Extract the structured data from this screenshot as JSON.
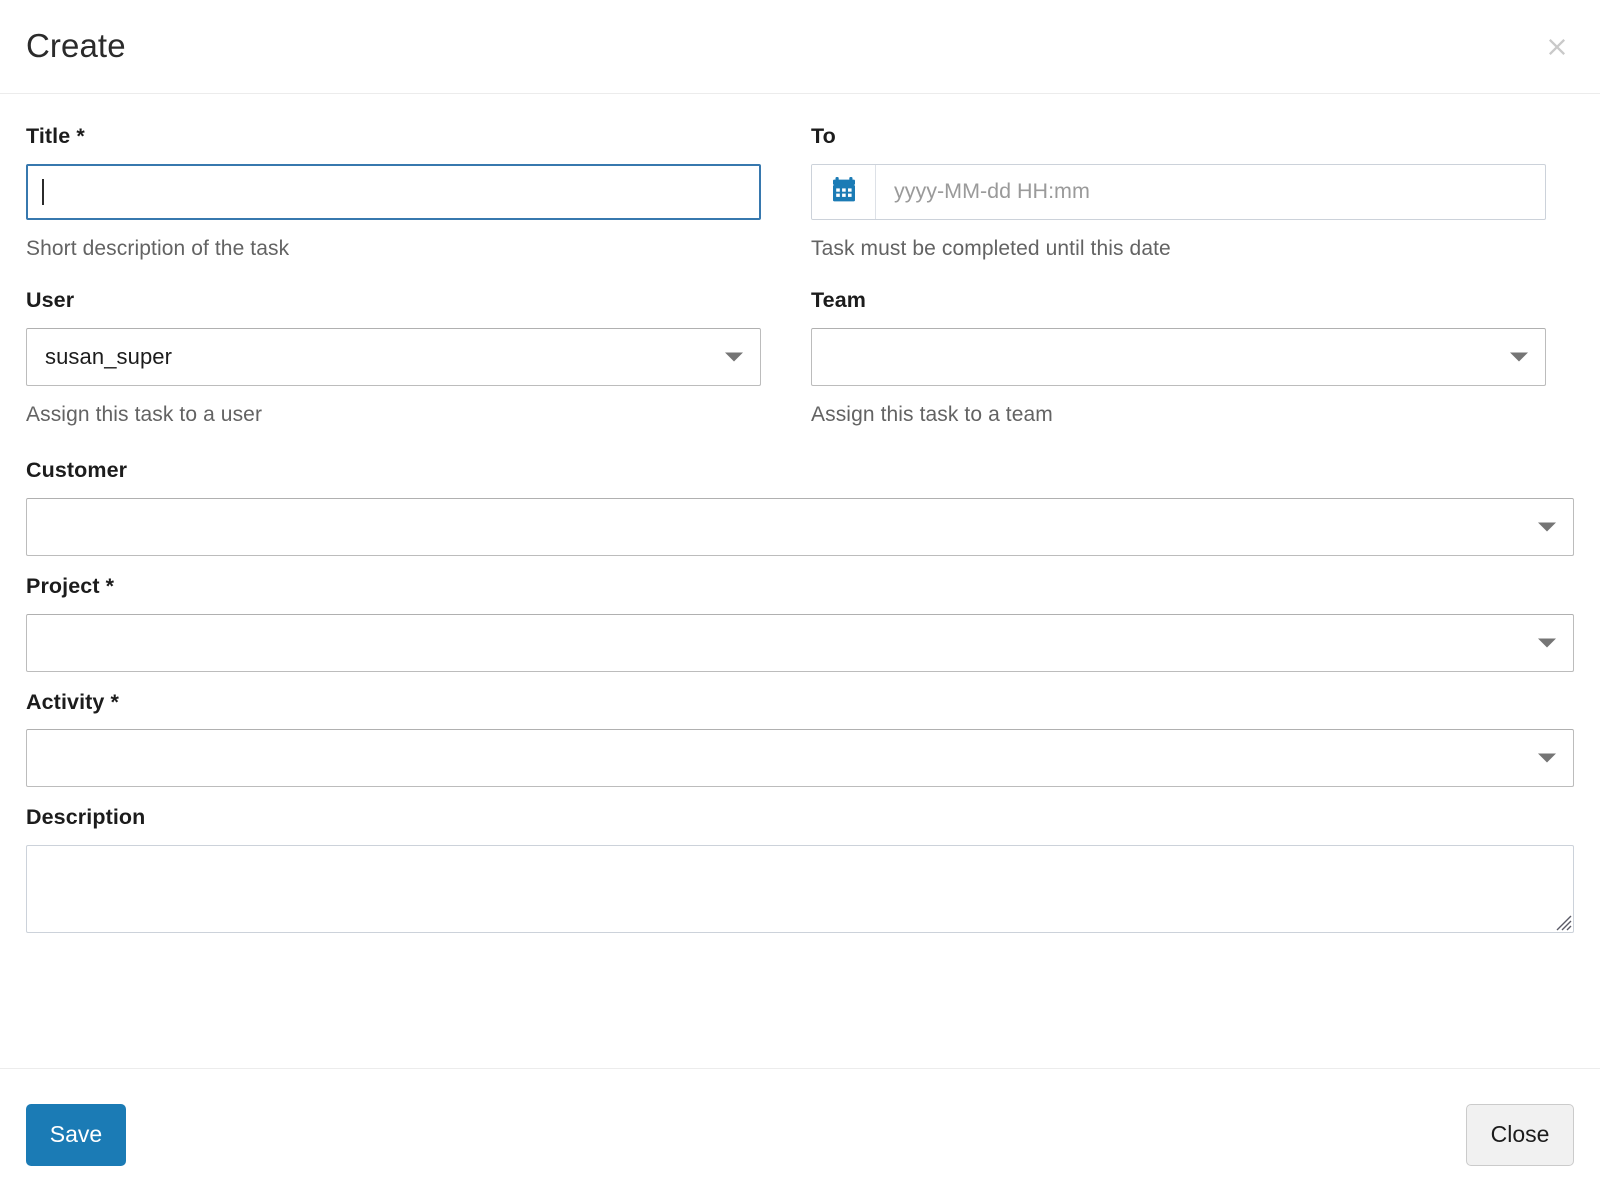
{
  "header": {
    "title": "Create",
    "close_icon": "close-icon"
  },
  "form": {
    "title_field": {
      "label": "Title *",
      "value": "",
      "placeholder": "",
      "help": "Short description of the task"
    },
    "to_field": {
      "label": "To",
      "value": "",
      "placeholder": "yyyy-MM-dd HH:mm",
      "help": "Task must be completed until this date",
      "icon": "calendar-icon"
    },
    "user_field": {
      "label": "User",
      "value": "susan_super",
      "help": "Assign this task to a user"
    },
    "team_field": {
      "label": "Team",
      "value": "",
      "help": "Assign this task to a team"
    },
    "customer_field": {
      "label": "Customer",
      "value": ""
    },
    "project_field": {
      "label": "Project *",
      "value": ""
    },
    "activity_field": {
      "label": "Activity *",
      "value": ""
    },
    "description_field": {
      "label": "Description",
      "value": "",
      "placeholder": ""
    }
  },
  "footer": {
    "save_label": "Save",
    "close_label": "Close"
  },
  "colors": {
    "primary": "#1b7bb5",
    "focus_border": "#3778ae",
    "calendar_icon": "#1b7bb5",
    "help_text": "#636363",
    "divider": "#ececec"
  }
}
